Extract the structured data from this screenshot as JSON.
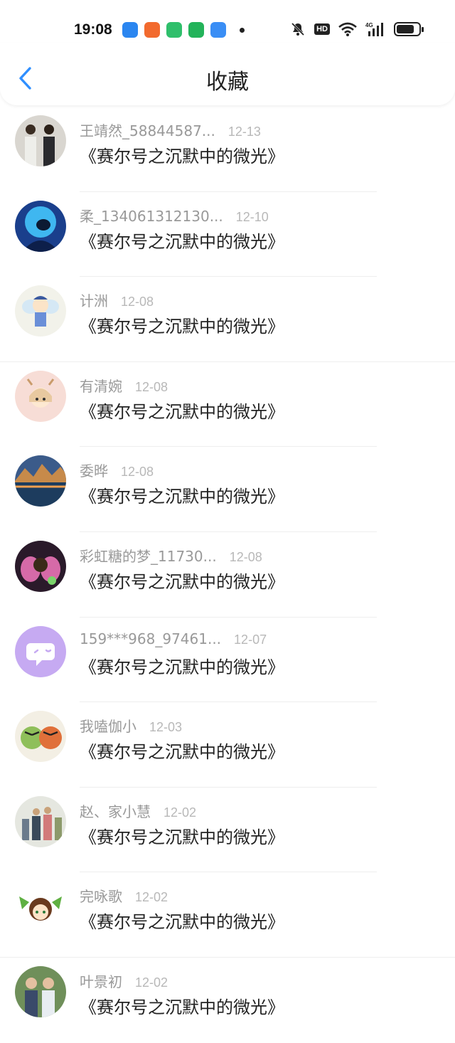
{
  "status": {
    "time": "19:08",
    "hd": "HD",
    "network": "4G"
  },
  "header": {
    "title": "收藏"
  },
  "items": [
    {
      "username": "王靖然_58844587...",
      "date": "12-13",
      "title": "《赛尔号之沉默中的微光》"
    },
    {
      "username": "柔_134061312130...",
      "date": "12-10",
      "title": "《赛尔号之沉默中的微光》"
    },
    {
      "username": "计洲",
      "date": "12-08",
      "title": "《赛尔号之沉默中的微光》"
    },
    {
      "username": "有清婉",
      "date": "12-08",
      "title": "《赛尔号之沉默中的微光》"
    },
    {
      "username": "委晔",
      "date": "12-08",
      "title": "《赛尔号之沉默中的微光》"
    },
    {
      "username": "彩虹糖的梦_11730...",
      "date": "12-08",
      "title": "《赛尔号之沉默中的微光》"
    },
    {
      "username": "159***968_97461...",
      "date": "12-07",
      "title": "《赛尔号之沉默中的微光》"
    },
    {
      "username": "我嗑伽小",
      "date": "12-03",
      "title": "《赛尔号之沉默中的微光》"
    },
    {
      "username": "赵、家小慧",
      "date": "12-02",
      "title": "《赛尔号之沉默中的微光》"
    },
    {
      "username": "完咏歌",
      "date": "12-02",
      "title": "《赛尔号之沉默中的微光》"
    },
    {
      "username": "叶景初",
      "date": "12-02",
      "title": "《赛尔号之沉默中的微光》"
    }
  ],
  "colors": {
    "accent": "#2f8fff",
    "text": "#222222",
    "muted": "#999999"
  }
}
